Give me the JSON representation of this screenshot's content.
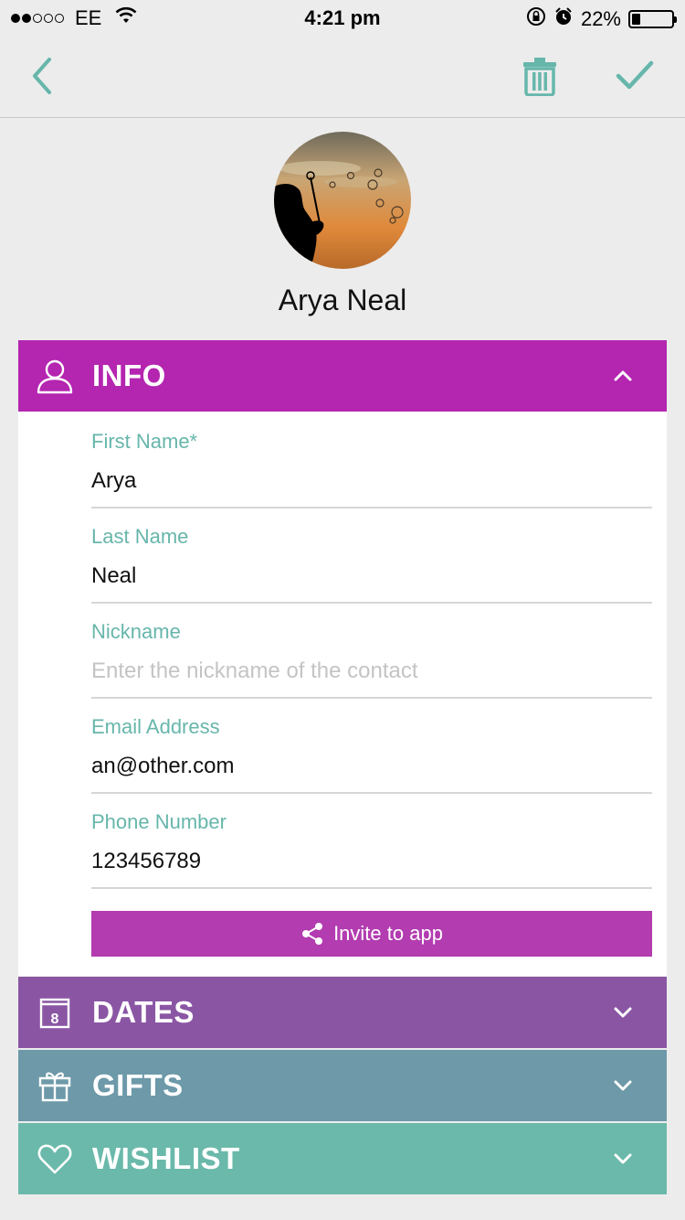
{
  "status_bar": {
    "carrier": "EE",
    "time": "4:21 pm",
    "battery_percent": "22%",
    "battery_level": 0.22,
    "signal_bars_filled": 2,
    "signal_bars_total": 5
  },
  "navbar": {
    "back_icon": "chevron-left-icon",
    "delete_icon": "trash-icon",
    "confirm_icon": "checkmark-icon",
    "accent_color": "#67b6ab"
  },
  "contact": {
    "name": "Arya Neal"
  },
  "sections": {
    "info": {
      "label": "INFO",
      "icon": "user-icon",
      "color": "#b425b0",
      "expanded": true
    },
    "dates": {
      "label": "DATES",
      "icon": "calendar-icon",
      "color": "#8a56a4",
      "expanded": false
    },
    "gifts": {
      "label": "GIFTS",
      "icon": "gift-icon",
      "color": "#6d99a9",
      "expanded": false
    },
    "wishlist": {
      "label": "WISHLIST",
      "icon": "heart-icon",
      "color": "#6ab9aa",
      "expanded": false
    }
  },
  "calendar_day": "8",
  "form": {
    "first_name": {
      "label": "First Name*",
      "value": "Arya"
    },
    "last_name": {
      "label": "Last Name",
      "value": "Neal"
    },
    "nickname": {
      "label": "Nickname",
      "value": "",
      "placeholder": "Enter the nickname of the contact"
    },
    "email": {
      "label": "Email Address",
      "value": "an@other.com"
    },
    "phone": {
      "label": "Phone Number",
      "value": "123456789"
    }
  },
  "invite_button": {
    "label": "Invite to app",
    "icon": "share-icon",
    "color": "#b23cb0"
  }
}
